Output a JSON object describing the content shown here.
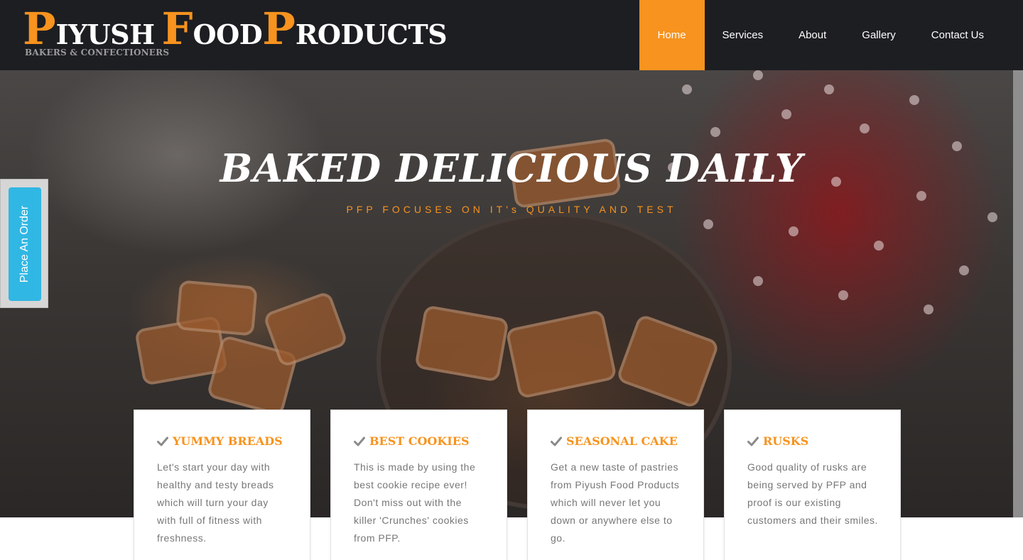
{
  "brand": {
    "logo_word1_initial": "P",
    "logo_word1_rest": "IYUSH",
    "logo_word2_initial": "F",
    "logo_word2_rest": "OOD",
    "logo_word3_initial": "P",
    "logo_word3_rest": "RODUCTS",
    "tagline": "BAKERS & CONFECTIONERS",
    "accent_color": "#f7931e",
    "header_bg": "#1d1e22"
  },
  "nav": {
    "items": [
      {
        "label": "Home",
        "active": true
      },
      {
        "label": "Services",
        "active": false
      },
      {
        "label": "About",
        "active": false
      },
      {
        "label": "Gallery",
        "active": false
      },
      {
        "label": "Contact Us",
        "active": false
      }
    ]
  },
  "side_tab": {
    "label": "Place An Order",
    "color": "#31b7e3"
  },
  "hero": {
    "title": "BAKED DELICIOUS DAILY",
    "subtitle": "PFP FOCUSES ON IT's QUALITY AND TEST"
  },
  "cards": [
    {
      "icon": "check-icon",
      "title": "YUMMY BREADS",
      "text": "Let's start your day with healthy and testy breads which will turn your day with full of fitness with freshness."
    },
    {
      "icon": "check-icon",
      "title": "BEST COOKIES",
      "text": "This is made by using the best cookie recipe ever! Don't miss out with the killer 'Crunches' cookies from PFP."
    },
    {
      "icon": "check-icon",
      "title": "SEASONAL CAKE",
      "text": "Get a new taste of pastries from Piyush Food Products which will never let you down or anywhere else to go."
    },
    {
      "icon": "check-icon",
      "title": "RUSKS",
      "text": "Good quality of rusks are being served by PFP and proof is our existing customers and their smiles."
    }
  ]
}
